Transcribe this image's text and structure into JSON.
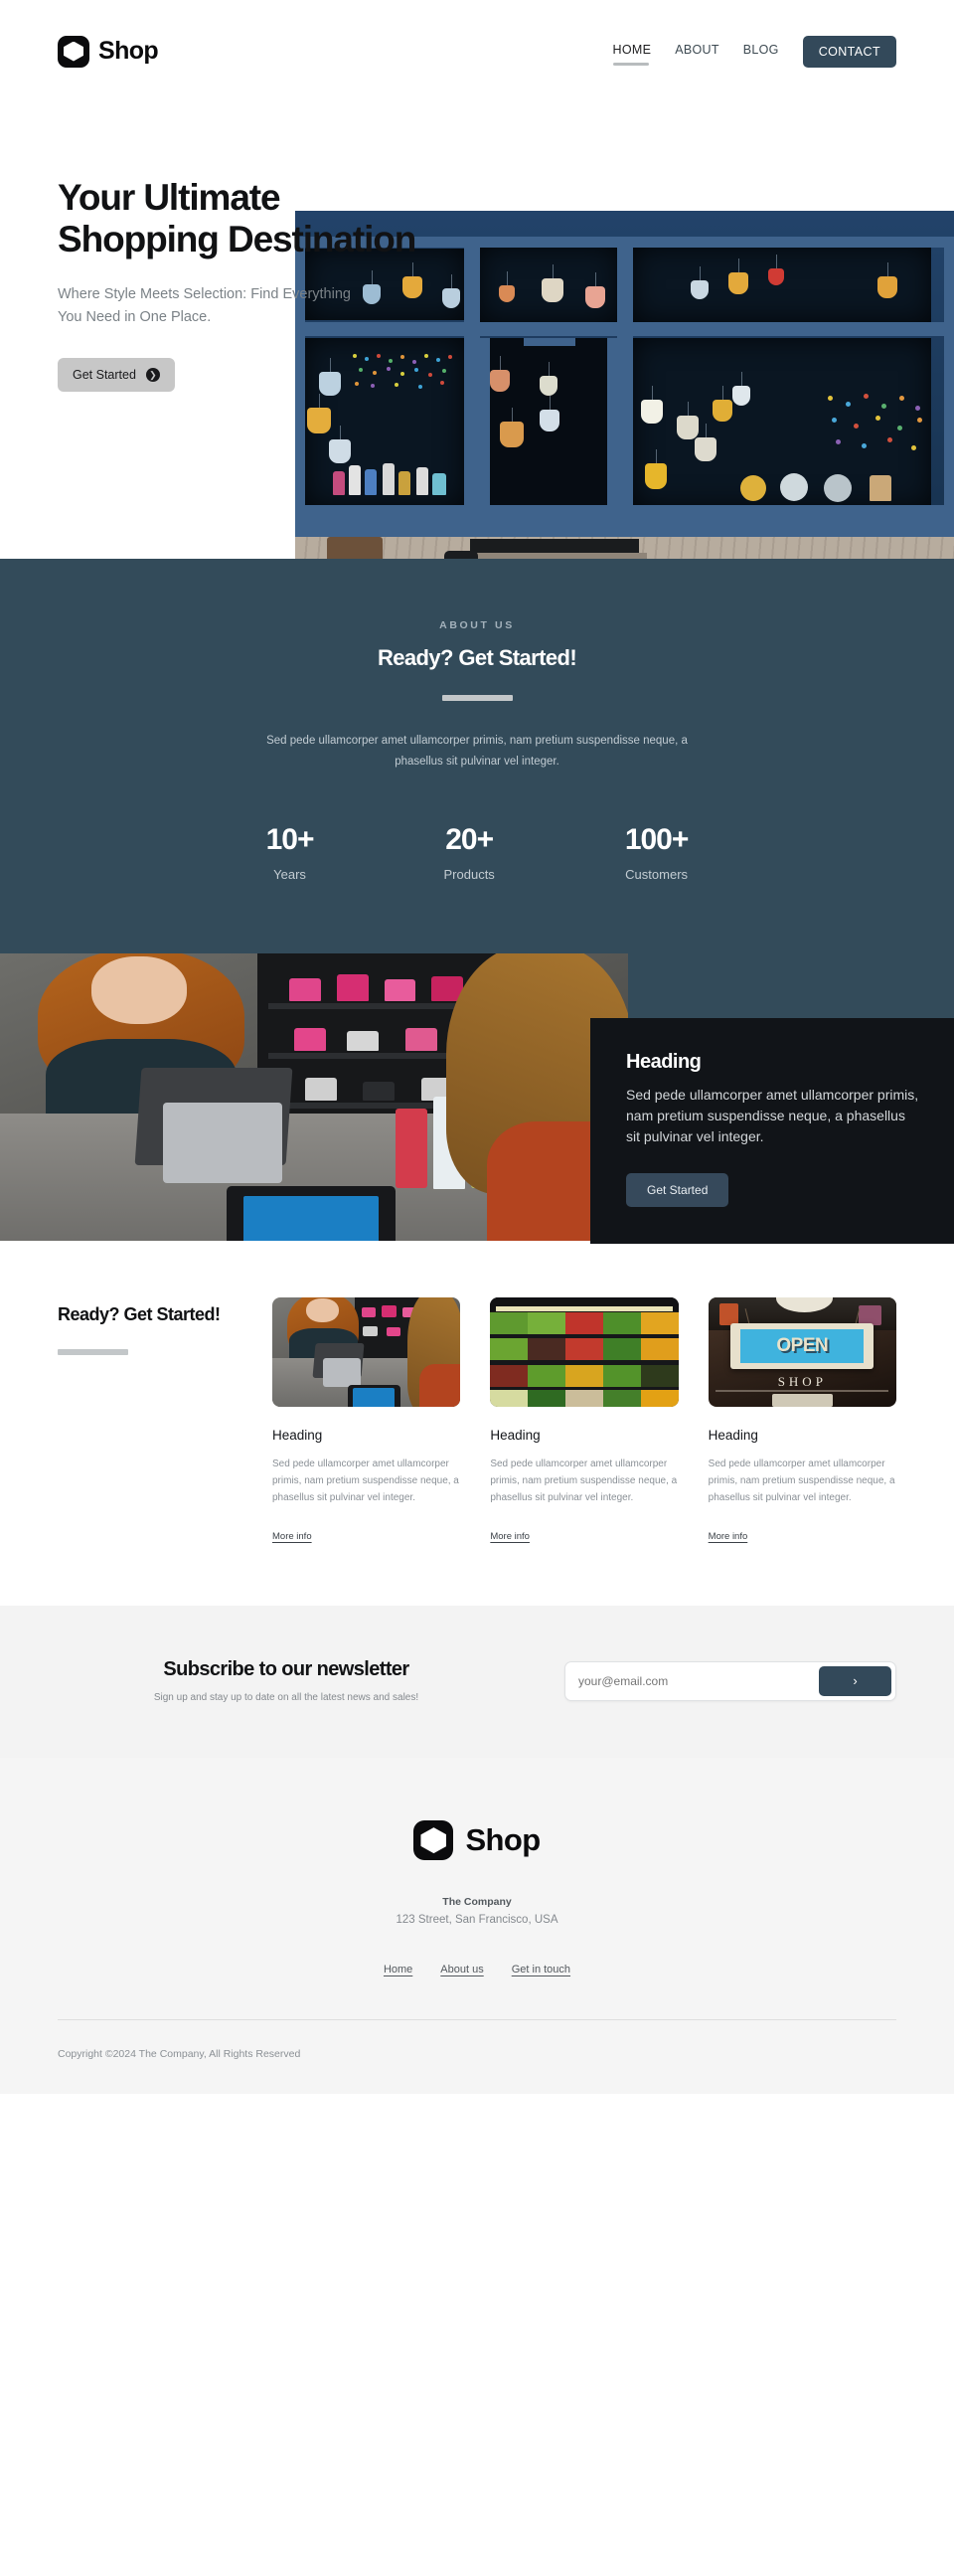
{
  "header": {
    "brand": "Shop",
    "nav": [
      {
        "label": "HOME",
        "active": true
      },
      {
        "label": "ABOUT",
        "active": false
      },
      {
        "label": "BLOG",
        "active": false
      }
    ],
    "cta": "CONTACT"
  },
  "hero": {
    "title": "Your Ultimate Shopping Destination",
    "subtitle": "Where Style Meets Selection: Find Everything You Need in One Place.",
    "button": "Get Started",
    "image_alt": "blue storefront with hanging lamps and bicycle"
  },
  "about": {
    "eyebrow": "ABOUT US",
    "title": "Ready? Get Started!",
    "text": "Sed pede ullamcorper amet ullamcorper primis, nam pretium suspendisse neque, a phasellus sit pulvinar vel integer.",
    "stats": [
      {
        "value": "10+",
        "label": "Years"
      },
      {
        "value": "20+",
        "label": "Products"
      },
      {
        "value": "100+",
        "label": "Customers"
      }
    ]
  },
  "feature": {
    "heading": "Heading",
    "text": "Sed pede ullamcorper amet ullamcorper primis, nam pretium suspendisse neque, a phasellus sit pulvinar vel integer.",
    "button": "Get Started",
    "image_alt": "shop clerk and customer paying with card terminal"
  },
  "cards_section": {
    "title": "Ready? Get Started!",
    "cards": [
      {
        "heading": "Heading",
        "text": "Sed pede ullamcorper amet ullamcorper primis, nam pretium suspendisse neque, a phasellus sit pulvinar vel integer.",
        "link": "More info",
        "image_alt": "shop clerk with tablet at checkout counter"
      },
      {
        "heading": "Heading",
        "text": "Sed pede ullamcorper amet ullamcorper primis, nam pretium suspendisse neque, a phasellus sit pulvinar vel integer.",
        "link": "More info",
        "image_alt": "grocery produce shelves with vegetables"
      },
      {
        "heading": "Heading",
        "text": "Sed pede ullamcorper amet ullamcorper primis, nam pretium suspendisse neque, a phasellus sit pulvinar vel integer.",
        "link": "More info",
        "image_alt": "OPEN SHOP sign hanging in window",
        "sign_text": "OPEN",
        "sign_sub": "SHOP"
      }
    ]
  },
  "newsletter": {
    "title": "Subscribe to our newsletter",
    "subtitle": "Sign up and stay up to date on all the latest news and sales!",
    "placeholder": "your@email.com",
    "value": "",
    "submit_icon": "›"
  },
  "footer": {
    "brand": "Shop",
    "company": "The Company",
    "address": "123 Street, San Francisco, USA",
    "links": [
      "Home",
      "About us",
      "Get in touch"
    ],
    "copyright": "Copyright ©2024 The Company, All Rights Reserved"
  },
  "colors": {
    "accent_dark": "#33495a",
    "about_bg": "#334b5a",
    "card_dark": "#111418",
    "rule": "#c3c7c9",
    "hero_button": "#c7c7c7"
  }
}
